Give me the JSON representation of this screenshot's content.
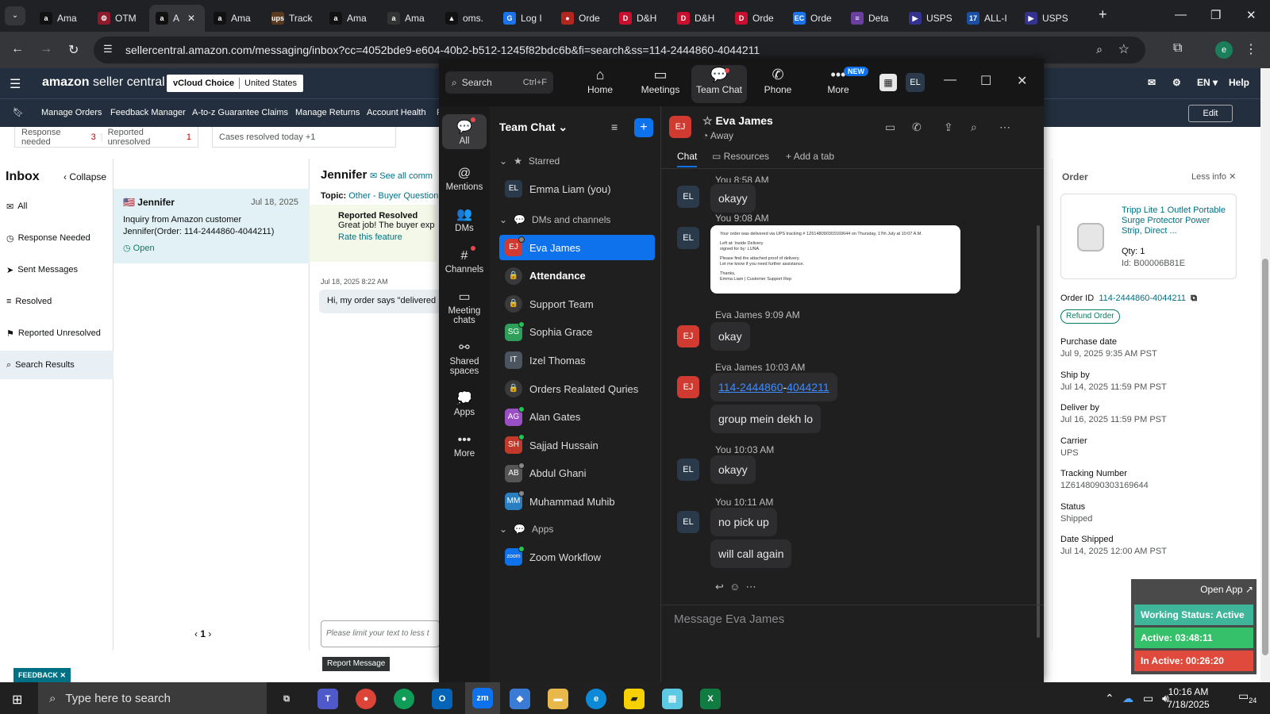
{
  "browser": {
    "tabs": [
      {
        "label": "Ama",
        "fav": "a",
        "color": "#111"
      },
      {
        "label": "OTM",
        "fav": "⚙",
        "color": "#8e1b2b"
      },
      {
        "label": "A",
        "fav": "a",
        "color": "#111",
        "active": true
      },
      {
        "label": "Ama",
        "fav": "a",
        "color": "#111"
      },
      {
        "label": "Track",
        "fav": "ups",
        "color": "#5a3b1f"
      },
      {
        "label": "Ama",
        "fav": "a",
        "color": "#111"
      },
      {
        "label": "Ama",
        "fav": "a",
        "color": "#333"
      },
      {
        "label": "oms.",
        "fav": "▲",
        "color": "#111"
      },
      {
        "label": "Log I",
        "fav": "G",
        "color": "#1a73e8"
      },
      {
        "label": "Orde",
        "fav": "●",
        "color": "#b3261e"
      },
      {
        "label": "D&H",
        "fav": "D",
        "color": "#c8102e"
      },
      {
        "label": "D&H",
        "fav": "D",
        "color": "#c8102e"
      },
      {
        "label": "Orde",
        "fav": "D",
        "color": "#c8102e"
      },
      {
        "label": "Orde",
        "fav": "EC",
        "color": "#1a73e8"
      },
      {
        "label": "Deta",
        "fav": "≡",
        "color": "#6b3fa0"
      },
      {
        "label": "USPS",
        "fav": "▶",
        "color": "#33338f"
      },
      {
        "label": "ALL-I",
        "fav": "17",
        "color": "#1a4fa3"
      },
      {
        "label": "USPS",
        "fav": "▶",
        "color": "#33338f"
      }
    ],
    "url": "sellercentral.amazon.com/messaging/inbox?cc=4052bde9-e604-40b2-b512-1245f82bdc6b&fi=search&ss=114-2444860-4044211",
    "profile_initial": "e"
  },
  "seller": {
    "logo_bold": "amazon",
    "logo_rest": " seller central",
    "store_name": "vCloud Choice",
    "store_region": "United States",
    "lang": "EN",
    "help": "Help",
    "nav": [
      "Manage Orders",
      "Feedback Manager",
      "A-to-z Guarantee Claims",
      "Manage Returns",
      "Account Health",
      "F"
    ],
    "edit": "Edit",
    "stats": {
      "response_needed_label": "Response needed",
      "response_needed_count": "3",
      "reported_unresolved_label": "Reported unresolved",
      "reported_unresolved_count": "1",
      "cases_resolved": "Cases resolved today +1"
    },
    "inbox": {
      "title": "Inbox",
      "collapse": "Collapse",
      "items": [
        {
          "label": "All",
          "icon": "✉"
        },
        {
          "label": "Response Needed",
          "icon": "◷"
        },
        {
          "label": "Sent Messages",
          "icon": "➤"
        },
        {
          "label": "Resolved",
          "icon": "≡"
        },
        {
          "label": "Reported Unresolved",
          "icon": "⚑"
        },
        {
          "label": "Search Results",
          "icon": "⌕"
        }
      ]
    },
    "thread": {
      "name": "Jennifer",
      "date": "Jul 18, 2025",
      "line1": "Inquiry from Amazon customer",
      "line2": "Jennifer(Order: 114-2444860-4044211)",
      "status": "Open",
      "page": "1"
    },
    "conversation": {
      "name": "Jennifer",
      "see_all": "See all comm",
      "topic_label": "Topic:",
      "topic_value": "Other - Buyer Question",
      "resolved_title": "Reported Resolved",
      "resolved_text": "Great job! The buyer exp",
      "rate": "Rate this feature",
      "msg_date": "Jul 18, 2025 8:22 AM",
      "msg_text": "Hi, my order says \"delivered",
      "limit_placeholder": "Please limit your text to less t",
      "report": "Report Message"
    },
    "order": {
      "title": "Order",
      "less_info": "Less info",
      "product_title": "Tripp Lite 1 Outlet Portable Surge Protector Power Strip, Direct ...",
      "qty": "Qty: 1",
      "id": "Id: B00006B81E",
      "order_id_label": "Order ID",
      "order_id": "114-2444860-4044211",
      "refund": "Refund Order",
      "fields": [
        {
          "label": "Purchase date",
          "value": "Jul 9, 2025 9:35 AM PST"
        },
        {
          "label": "Ship by",
          "value": "Jul 14, 2025 11:59 PM PST"
        },
        {
          "label": "Deliver by",
          "value": "Jul 16, 2025 11:59 PM PST"
        },
        {
          "label": "Carrier",
          "value": "UPS"
        },
        {
          "label": "Tracking Number",
          "value": "1Z6148090303169644"
        },
        {
          "label": "Status",
          "value": "Shipped"
        },
        {
          "label": "Date Shipped",
          "value": "Jul 14, 2025 12:00 AM PST"
        }
      ]
    },
    "feedback": "FEEDBACK"
  },
  "zoom": {
    "search": "Search",
    "search_kb": "Ctrl+F",
    "nav": [
      {
        "label": "Home",
        "icon": "⌂"
      },
      {
        "label": "Meetings",
        "icon": "▭"
      },
      {
        "label": "Team Chat",
        "icon": "💬",
        "active": true
      },
      {
        "label": "Phone",
        "icon": "✆"
      },
      {
        "label": "More",
        "icon": "•••"
      }
    ],
    "new_badge": "NEW",
    "user_initials": "EL",
    "rail": [
      {
        "label": "All",
        "icon": "💬",
        "active": true,
        "dot": true
      },
      {
        "label": "Mentions",
        "icon": "@"
      },
      {
        "label": "DMs",
        "icon": "👥"
      },
      {
        "label": "Channels",
        "icon": "#",
        "dot": true
      },
      {
        "label": "Meeting chats",
        "icon": "▭"
      },
      {
        "label": "Shared spaces",
        "icon": "⚯"
      },
      {
        "label": "Apps",
        "icon": "💭"
      },
      {
        "label": "More",
        "icon": "•••"
      }
    ],
    "list_title": "Team Chat",
    "sections": {
      "starred": "Starred",
      "dms": "DMs and channels",
      "apps": "Apps"
    },
    "starred": [
      {
        "initials": "EL",
        "name": "Emma Liam (you)",
        "color": "#2b3a4a"
      }
    ],
    "items": [
      {
        "initials": "EJ",
        "name": "Eva James",
        "color": "#d03a31",
        "selected": true,
        "presence": "away"
      },
      {
        "initials": "🔒",
        "name": "Attendance",
        "color": "lock",
        "bold": true
      },
      {
        "initials": "🔒",
        "name": "Support Team",
        "color": "lock"
      },
      {
        "initials": "SG",
        "name": "Sophia Grace",
        "color": "#2e9e5b",
        "presence": "online"
      },
      {
        "initials": "IT",
        "name": "Izel Thomas",
        "color": "#4a5560"
      },
      {
        "initials": "🔒",
        "name": "Orders Realated Quries",
        "color": "lock"
      },
      {
        "initials": "AG",
        "name": "Alan Gates",
        "color": "#9b4fc4",
        "presence": "online"
      },
      {
        "initials": "SH",
        "name": "Sajjad Hussain",
        "color": "#c0392b",
        "presence": "online"
      },
      {
        "initials": "AB",
        "name": "Abdul Ghani",
        "color": "#555",
        "presence": "away"
      },
      {
        "initials": "MM",
        "name": "Muhammad Muhib",
        "color": "#2a7fc1",
        "presence": "away"
      }
    ],
    "apps": [
      {
        "initials": "zoom",
        "name": "Zoom Workflow",
        "color": "#0e72ed",
        "presence": "online"
      }
    ],
    "chat": {
      "initials": "EJ",
      "name": "Eva James",
      "status": "Away",
      "tabs": [
        "Chat",
        "Resources",
        "Add a tab"
      ],
      "messages": [
        {
          "head": "You 8:58 AM",
          "av": "EL",
          "text": "okayy"
        },
        {
          "head": "You 9:08 AM",
          "av": "EL"
        },
        {
          "head": "Eva James 9:09 AM",
          "av": "EJ",
          "text": "okay"
        },
        {
          "head": "Eva James 10:03 AM",
          "av": "EJ",
          "link1": "114-2444860",
          "link2": "4044211",
          "text2": "group mein dekh lo"
        },
        {
          "head": "You 10:03 AM",
          "av": "EL",
          "text": "okayy"
        },
        {
          "head": "You 10:11 AM",
          "av": "EL",
          "text": "no pick up",
          "text2": "will call again"
        }
      ],
      "image_lines": [
        "Your order was delivered via UPS tracking # 1Z6148090303169644 on Thursday, 17th July at 10:07 A.M.",
        "Left at: Inside Delivery",
        "signed for by: LUNA",
        "Please find the attached proof of delivery.",
        "Let me know if you need further assistance.",
        "Thanks,",
        "Emma Liam | Customer Support Rep"
      ],
      "composer_placeholder": "Message Eva James"
    }
  },
  "work_status": {
    "open_app": "Open App ↗",
    "status": "Working Status: Active",
    "active": "Active: 03:48:11",
    "inactive": "In Active: 00:26:20",
    "colors": {
      "status": "#3fb59a",
      "active": "#35c06a",
      "inactive": "#e04a3c"
    }
  },
  "taskbar": {
    "search": "Type here to search",
    "time": "10:16 AM",
    "date": "7/18/2025",
    "notif_count": "24"
  }
}
